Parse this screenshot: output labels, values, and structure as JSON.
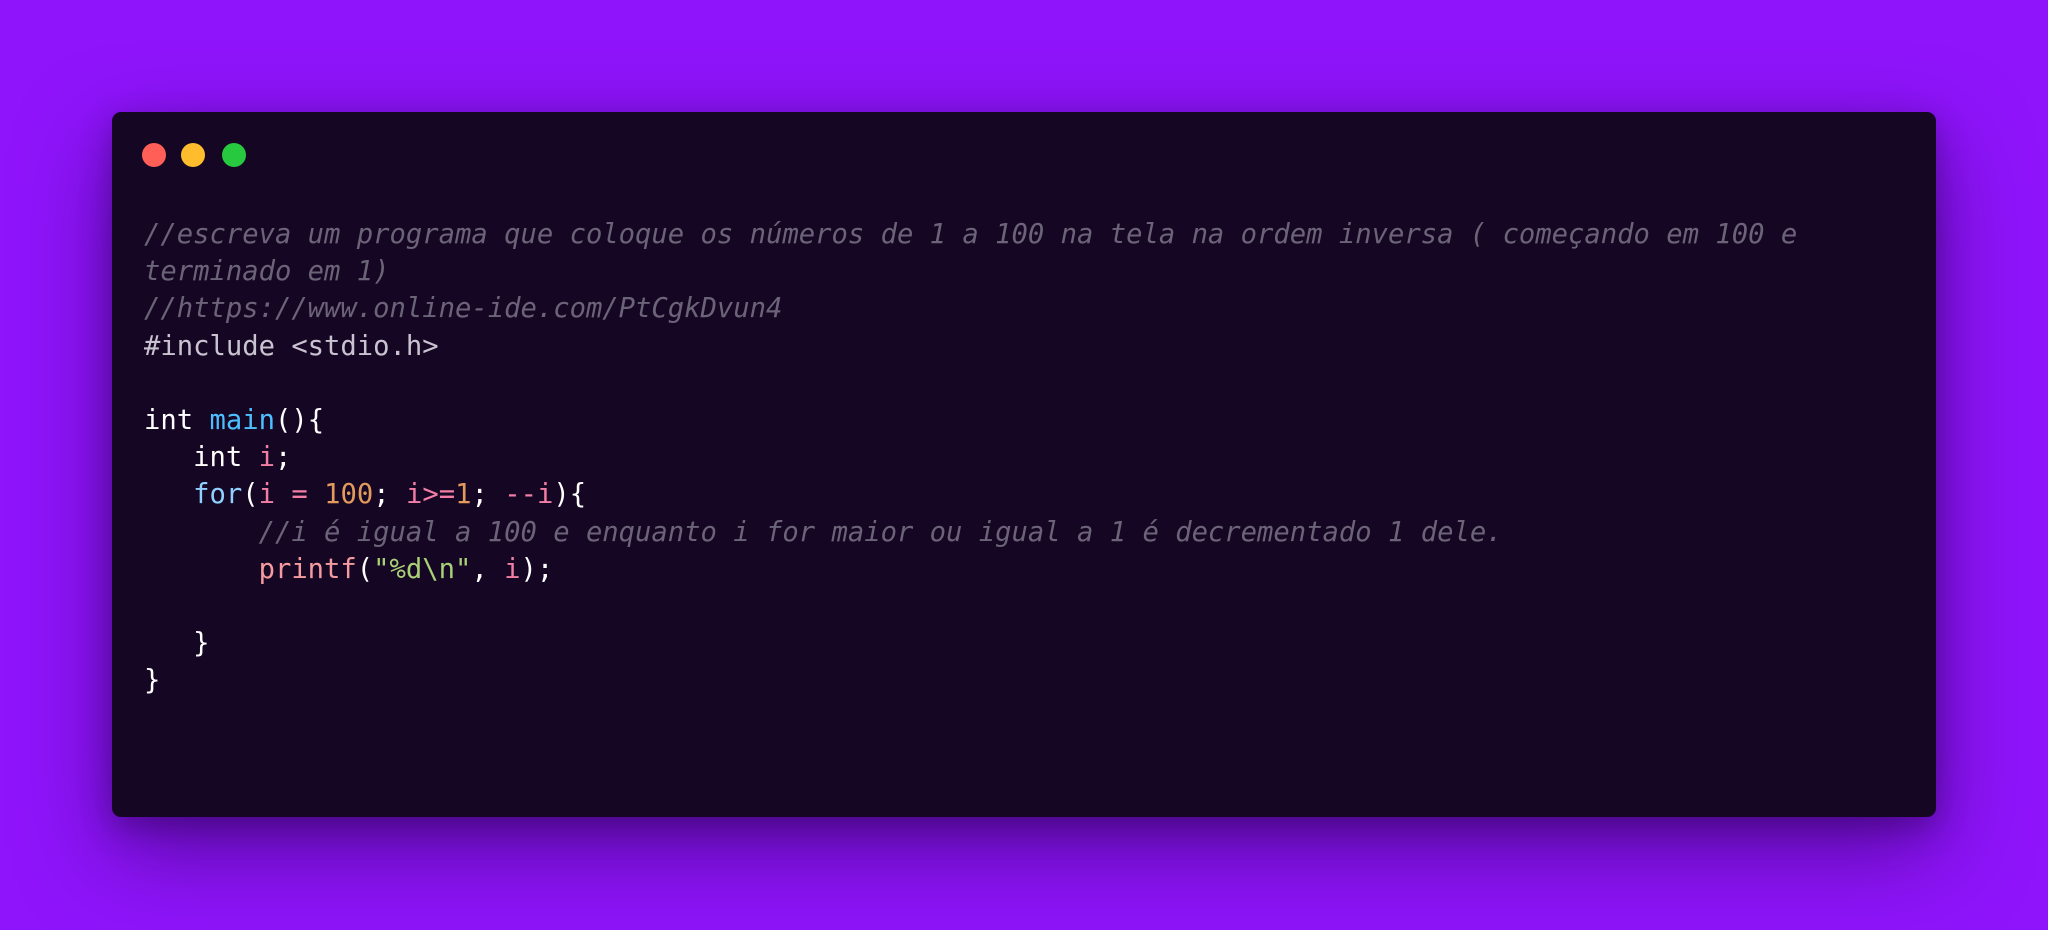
{
  "window": {
    "controls": {
      "close_color": "#ff5f56",
      "minimize_color": "#ffbd2e",
      "maximize_color": "#27c93f"
    },
    "background_color": "#150623"
  },
  "page": {
    "background_color": "#8f14fb"
  },
  "code": {
    "language": "c",
    "comment_1": "//escreva um programa que coloque os números de 1 a 100 na tela na ordem inversa ( começando em 100 e terminado em 1)",
    "comment_2": "//https://www.online-ide.com/PtCgkDvun4",
    "include": "#include <stdio.h>",
    "main_type": "int",
    "main_name": "main",
    "main_parens": "(){",
    "decl_type": "int",
    "decl_var": "i",
    "decl_end": ";",
    "for_kw": "for",
    "for_open": "(",
    "for_init_var": "i",
    "for_assign": "=",
    "for_init_val": "100",
    "for_sep1": ";",
    "for_cond_var": "i",
    "for_cond_op": ">=",
    "for_cond_val": "1",
    "for_sep2": ";",
    "for_dec_op": "--",
    "for_dec_var": "i",
    "for_close": "){",
    "comment_3": "//i é igual a 100 e enquanto i for maior ou igual a 1 é decrementado 1 dele.",
    "printf_name": "printf",
    "printf_open": "(",
    "printf_str": "\"%d\\n\"",
    "printf_comma": ",",
    "printf_var": "i",
    "printf_close": ");",
    "close_for": "}",
    "close_main": "}"
  }
}
